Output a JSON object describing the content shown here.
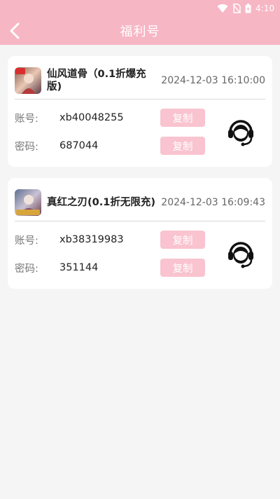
{
  "status_bar": {
    "time": "4:10"
  },
  "app_bar": {
    "title": "福利号"
  },
  "accounts": [
    {
      "game_name": "仙风道骨（0.1折爆充版)",
      "time": "2024-12-03 16:10:00",
      "account_label": "账号:",
      "account_value": "xb40048255",
      "password_label": "密码:",
      "password_value": "687044",
      "copy_label": "复制"
    },
    {
      "game_name": "真红之刃(0.1折无限充)",
      "time": "2024-12-03 16:09:43",
      "account_label": "账号:",
      "account_value": "xb38319983",
      "password_label": "密码:",
      "password_value": "351144",
      "copy_label": "复制"
    }
  ],
  "colors": {
    "accent": "#f7b6c4",
    "copy_button": "#f9c3cf"
  },
  "icons": {
    "back": "chevron-left-icon",
    "service": "customer-service-headset-icon"
  }
}
